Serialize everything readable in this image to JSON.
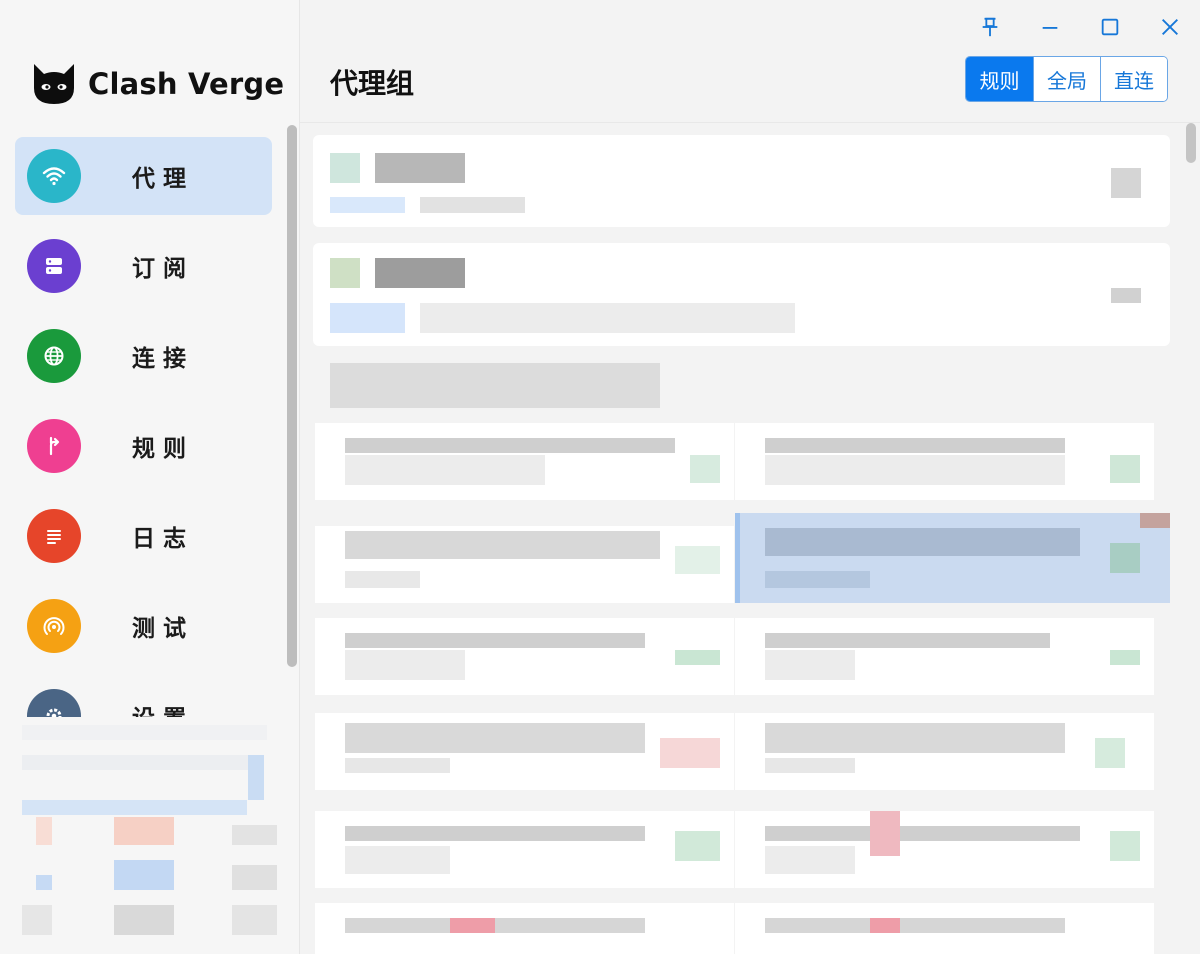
{
  "app": {
    "name": "Clash Verge"
  },
  "sidebar": {
    "items": [
      {
        "label": "代理",
        "icon": "wifi-icon",
        "color": "#2ab6c9",
        "active": true
      },
      {
        "label": "订阅",
        "icon": "server-icon",
        "color": "#6b3fd0",
        "active": false
      },
      {
        "label": "连接",
        "icon": "globe-icon",
        "color": "#1a9a3c",
        "active": false
      },
      {
        "label": "规则",
        "icon": "fork-arrow-icon",
        "color": "#ef3f91",
        "active": false
      },
      {
        "label": "日志",
        "icon": "list-lines-icon",
        "color": "#e6452a",
        "active": false
      },
      {
        "label": "测试",
        "icon": "signal-icon",
        "color": "#f5a113",
        "active": false
      },
      {
        "label": "设置",
        "icon": "gear-icon",
        "color": "#4a6585",
        "active": false
      }
    ]
  },
  "header": {
    "title": "代理组"
  },
  "mode_switch": {
    "options": [
      "规则",
      "全局",
      "直连"
    ],
    "selected": "规则"
  },
  "colors": {
    "accent": "#0a79ee",
    "active_nav_bg": "#d3e3f7",
    "selected_tile_bg": "#cadaf0"
  }
}
